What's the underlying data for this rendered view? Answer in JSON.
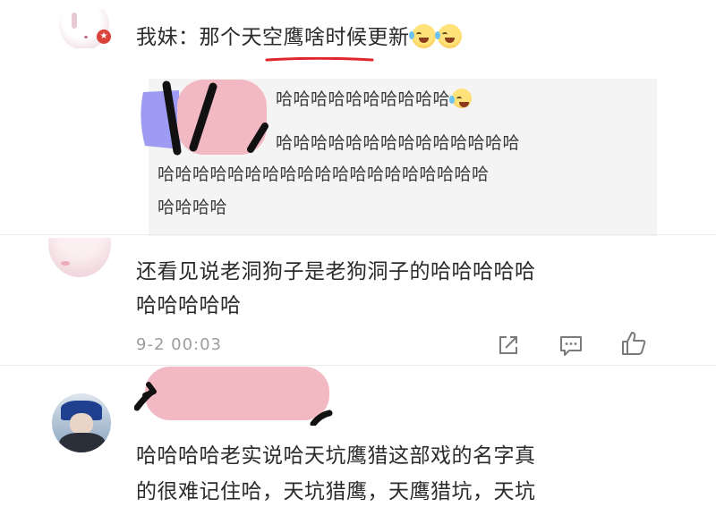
{
  "comment_top": {
    "author": "我妹：",
    "text": "那个天空鹰啥时候更新",
    "emojis": [
      "laugh-cry-emoji",
      "laugh-cry-emoji"
    ],
    "badge_icon": "verified-badge-icon",
    "underline_color": "#e0262b"
  },
  "quote": {
    "lines": [
      "哈哈哈哈哈哈哈哈哈哈",
      "哈哈哈哈哈哈哈哈哈哈哈哈哈哈",
      "哈哈哈哈哈哈哈哈哈哈哈哈哈哈哈哈哈哈哈",
      "哈哈哈哈"
    ],
    "emoji": "laugh-cry-emoji",
    "background": "#f4f4f4"
  },
  "comment_2": {
    "lines": [
      "还看见说老洞狗子是老狗洞子的哈哈哈哈哈",
      "哈哈哈哈哈"
    ],
    "time": "9-2 00:03",
    "actions": {
      "share_icon": "share-icon",
      "comment_icon": "comment-icon",
      "like_icon": "thumbs-up-icon"
    }
  },
  "comment_3": {
    "lines": [
      "哈哈哈哈老实说哈天坑鹰猎这部戏的名字真",
      "的很难记住哈，天坑猎鹰，天鹰猎坑，天坑"
    ]
  },
  "colors": {
    "text": "#2b2b2b",
    "muted": "#9c9c9c",
    "redaction_pink": "#f3b9c3",
    "redaction_purple": "#9d9cf2"
  }
}
